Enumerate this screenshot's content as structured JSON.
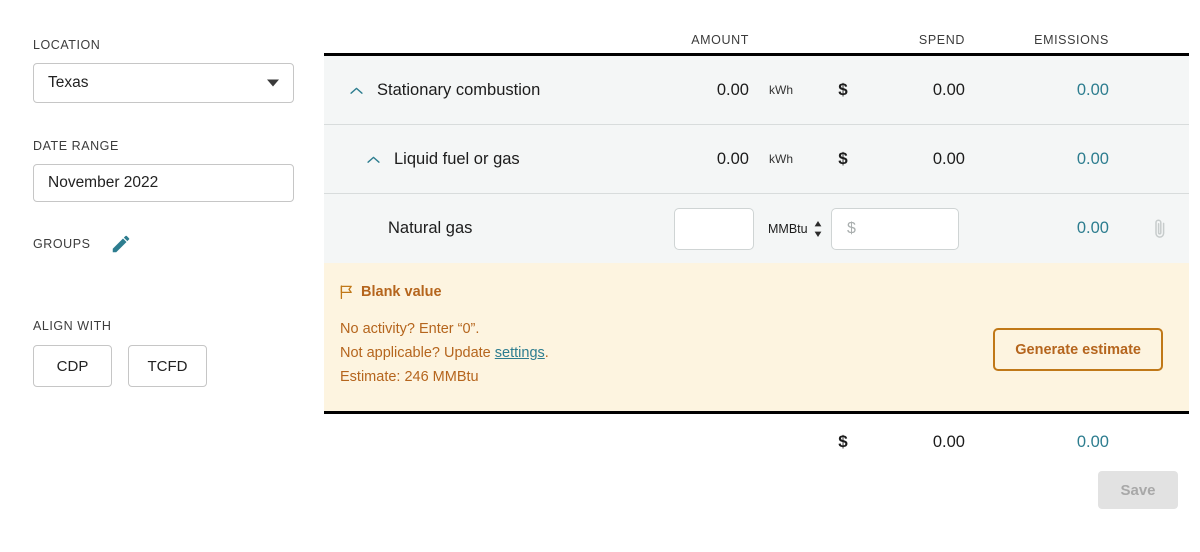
{
  "sidebar": {
    "location": {
      "label": "LOCATION",
      "value": "Texas",
      "icon": "chevron-down-icon"
    },
    "date_range": {
      "label": "DATE RANGE",
      "value": "November 2022"
    },
    "groups": {
      "label": "GROUPS",
      "edit_icon": "pencil-icon"
    },
    "align_with": {
      "label": "ALIGN WITH",
      "options": [
        {
          "label": "CDP"
        },
        {
          "label": "TCFD"
        }
      ]
    }
  },
  "table": {
    "headers": {
      "name": "",
      "amount": "AMOUNT",
      "spend": "SPEND",
      "emissions": "EMISSIONS"
    },
    "rows": [
      {
        "name": "Stationary combustion",
        "level": 0,
        "chevron": "chevron-up-icon",
        "amount": "0.00",
        "unit": "kWh",
        "currency": "$",
        "spend": "0.00",
        "emissions": "0.00"
      },
      {
        "name": "Liquid fuel or gas",
        "level": 1,
        "chevron": "chevron-up-icon",
        "amount": "0.00",
        "unit": "kWh",
        "currency": "$",
        "spend": "0.00",
        "emissions": "0.00"
      }
    ],
    "leaf_row": {
      "name": "Natural gas",
      "amount_value": "",
      "amount_placeholder": "",
      "unit": "MMBtu",
      "unit_stepper_icon": "stepper-updown-icon",
      "spend_value": "",
      "spend_placeholder": "$",
      "emissions": "0.00",
      "attachment_icon": "paperclip-icon"
    }
  },
  "alert": {
    "icon": "flag-icon",
    "title": "Blank value",
    "line1": "No activity? Enter “0”.",
    "line2_prefix": "Not applicable? Update ",
    "line2_link": "settings",
    "line2_suffix": ".",
    "line3": "Estimate: 246 MMBtu",
    "button_label": "Generate estimate"
  },
  "footer": {
    "currency": "$",
    "spend_total": "0.00",
    "emissions_total": "0.00",
    "save_label": "Save"
  },
  "colors": {
    "accent_teal": "#2d7d8f",
    "alert_text": "#b5651d",
    "alert_bg": "#fdf4e0",
    "alert_border": "#c07818",
    "row_bg": "#f4f6f6"
  }
}
